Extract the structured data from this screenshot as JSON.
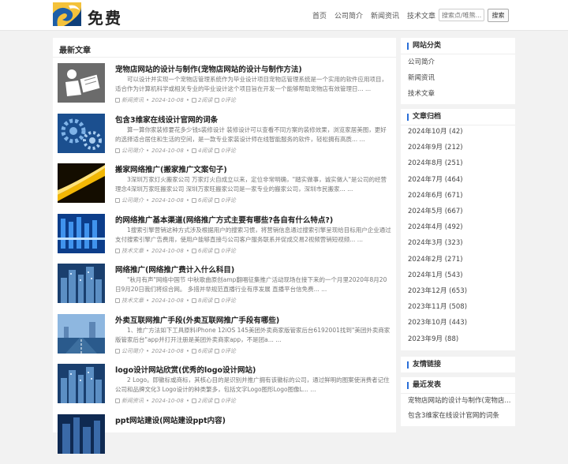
{
  "header": {
    "logo_text": "免费",
    "nav": [
      "首页",
      "公司简介",
      "新闻资讯",
      "技术文章"
    ],
    "search_placeholder": "搜索点/唯熊...",
    "search_button": "搜索"
  },
  "main": {
    "section_title": "最新文章",
    "articles": [
      {
        "title": "宠物店网站的设计与制作(宠物店网站的设计与制作方法)",
        "summary": "可以设计并实现一个宠物店管理系统作为毕业设计项目宠物店管理系统是一个实用的软件应用项目，适合作为计算机科学或相关专业的毕业设计这个项目旨在开发一个能够帮助宠物店有效管理日... ...",
        "category": "新闻资讯",
        "date": "2024-10-08",
        "views": "2阅读",
        "comments": "0评论",
        "thumb_icon": "reading-person-icon"
      },
      {
        "title": "包含3维家在线设计官网的词条",
        "summary": "算一算你家装修要花多少钱s装修设计 装修设计可以查看不同方案的装修效果，浏览家居美图，更好的选择适合居住和生活的空间，是一款专业家装设计师在线智能服务的软件，轻松拥有高质... ...",
        "category": "公司简介",
        "date": "2024-10-08",
        "views": "4阅读",
        "comments": "0评论",
        "thumb_icon": "gears-icon"
      },
      {
        "title": "搬家网络推广(搬家推广文案句子)",
        "summary": "3深圳万家灯火搬家公司 万家灯火自成立以来，定位非常明确，\"踏实做事，诚实做人\"是公司的经营理念4深圳万家旺搬家公司 深圳万家旺搬家公司是一家专业的搬家公司，深圳市民搬家... ...",
        "category": "公司简介",
        "date": "2024-10-08",
        "views": "6阅读",
        "comments": "0评论",
        "thumb_icon": "light-streak-icon"
      },
      {
        "title": "的网络推广基本渠道(网络推广方式主要有哪些?各自有什么特点?)",
        "summary": "1搜索引擎营销这种方式涉及根据用户的搜索习惯，将营销信息通过搜索引擎呈现给目标用户企业通过支付搜索引擎广告费用，使用户能够直接与公司客户服务联系并促成交易2视频营销短视频... ...",
        "category": "技术文章",
        "date": "2024-10-08",
        "views": "6阅读",
        "comments": "0评论",
        "thumb_icon": "data-grid-icon"
      },
      {
        "title": "网络推广(网络推广费计入什么科目)",
        "summary": "\"秋月有声\"网络中国节 中秋歌曲原创amp翻唱征集推广活动现场在接下来的一个月里2020年8月20日9月20日我们将综合网。 多措并举规范直播行业有序发展 直播平台信免费... ...",
        "category": "技术文章",
        "date": "2024-10-08",
        "views": "8阅读",
        "comments": "0评论",
        "thumb_icon": "city-skyline-icon"
      },
      {
        "title": "外卖互联网推广手段(外卖互联网推广手段有哪些)",
        "summary": "1、推广方法如下工具原料iPhone 12iOS 145美团外卖商家版管家后台6192001找到\"美团外卖商家版管家后台\"app并打开注册是美团外卖商家app，不是团a... ...",
        "category": "公司简介",
        "date": "2024-10-08",
        "views": "6阅读",
        "comments": "0评论",
        "thumb_icon": "highway-icon"
      },
      {
        "title": "logo设计网站欣赏(优秀的logo设计网站)",
        "summary": "2 Logo。即徽标或商标，其核心目的是识别并推广拥有该徽标的公司，通过鲜明的图案使消费者记住公司和品牌文化3 Logo设计的种类繁多，包括文字Logo图形Logo图像L... ...",
        "category": "新闻资讯",
        "date": "2024-10-08",
        "views": "2阅读",
        "comments": "0评论",
        "thumb_icon": "city-skyline-icon"
      },
      {
        "title": "ppt网站建设(网站建设ppt内容)",
        "summary": "",
        "category": "",
        "date": "",
        "views": "",
        "comments": "",
        "thumb_icon": "city-night-icon"
      }
    ]
  },
  "sidebar": {
    "categories_title": "网站分类",
    "categories": [
      "公司简介",
      "新闻资讯",
      "技术文章"
    ],
    "archive_title": "文章归档",
    "archives": [
      "2024年10月 (42)",
      "2024年9月 (212)",
      "2024年8月 (251)",
      "2024年7月 (464)",
      "2024年6月 (671)",
      "2024年5月 (667)",
      "2024年4月 (492)",
      "2024年3月 (323)",
      "2024年2月 (271)",
      "2024年1月 (543)",
      "2023年12月 (653)",
      "2023年11月 (508)",
      "2023年10月 (443)",
      "2023年9月 (88)"
    ],
    "links_title": "友情链接",
    "recent_title": "最近发表",
    "recent": [
      "宠物店网站的设计与制作(宠物店...",
      "包含3维家在线设计官网的词条"
    ]
  },
  "colors": {
    "accent": "#2a6fd8",
    "background": "#f2f2f2",
    "panel": "#ffffff"
  }
}
